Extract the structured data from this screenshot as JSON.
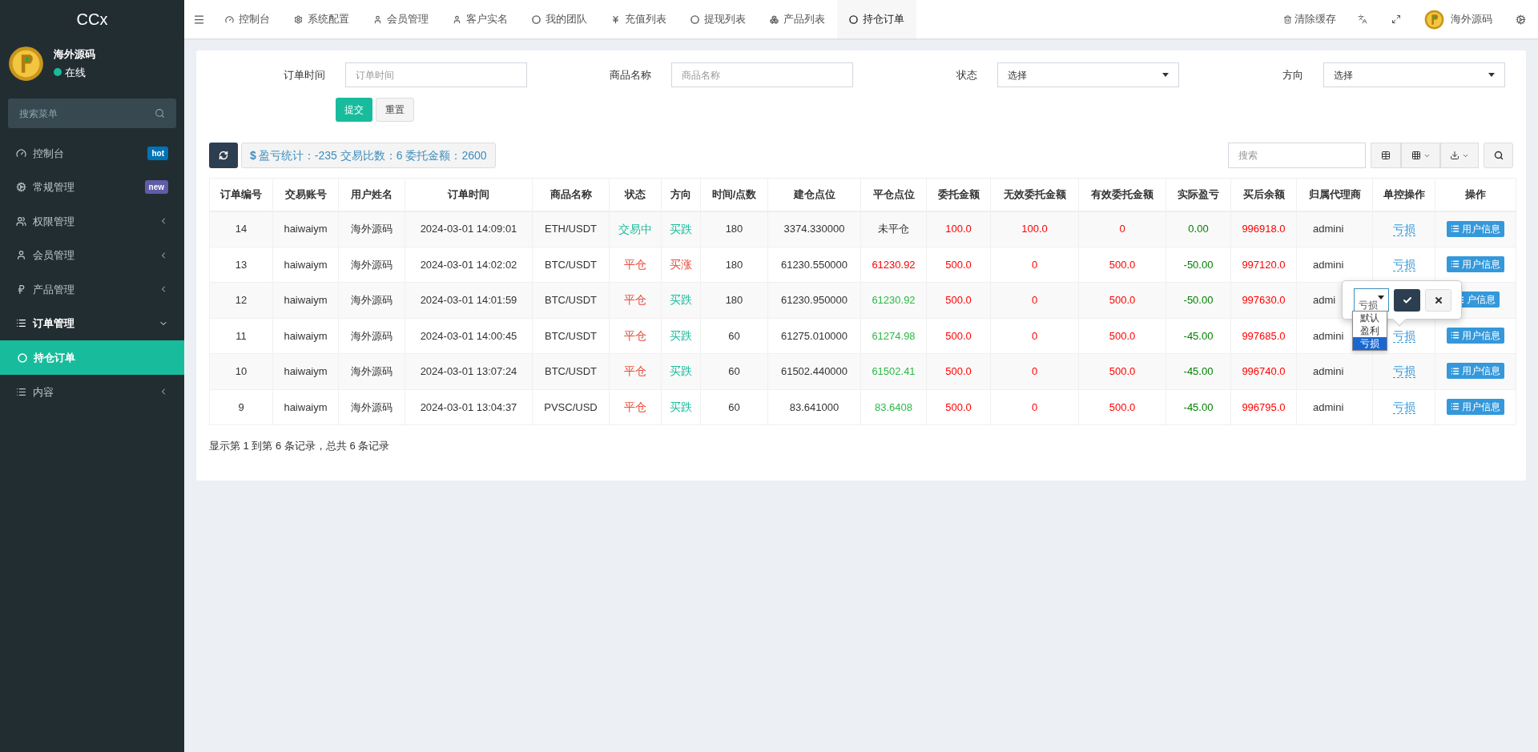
{
  "sidebar": {
    "brand": "CCx",
    "user": {
      "name": "海外源码",
      "status": "在线",
      "online": true
    },
    "search": {
      "placeholder": "搜索菜单"
    },
    "items": [
      {
        "label": "控制台",
        "badge": {
          "text": "hot",
          "color": "#0073b7"
        },
        "selected": false
      },
      {
        "label": "常规管理",
        "badge": {
          "text": "new",
          "color": "#605ca8"
        },
        "selected": false
      },
      {
        "label": "权限管理",
        "has_children": true,
        "expanded": false,
        "selected": false
      },
      {
        "label": "会员管理",
        "has_children": true,
        "expanded": false,
        "selected": false
      },
      {
        "label": "产品管理",
        "has_children": true,
        "expanded": false,
        "selected": false
      },
      {
        "label": "订单管理",
        "has_children": true,
        "expanded": true,
        "selected": false,
        "children": [
          {
            "label": "持仓订单",
            "selected": true
          }
        ]
      },
      {
        "label": "内容",
        "has_children": true,
        "expanded": false,
        "selected": false
      }
    ]
  },
  "topbar": {
    "tabs": [
      {
        "label": "控制台",
        "selected": false
      },
      {
        "label": "系统配置",
        "selected": false
      },
      {
        "label": "会员管理",
        "selected": false
      },
      {
        "label": "客户实名",
        "selected": false
      },
      {
        "label": "我的团队",
        "selected": false
      },
      {
        "label": "充值列表",
        "selected": false
      },
      {
        "label": "提现列表",
        "selected": false
      },
      {
        "label": "产品列表",
        "selected": false
      },
      {
        "label": "持仓订单",
        "selected": true
      }
    ],
    "clear_cache": "清除缓存",
    "user_name": "海外源码"
  },
  "filters": [
    {
      "label": "订单时间",
      "kind": "input",
      "placeholder": "订单时间"
    },
    {
      "label": "商品名称",
      "kind": "input",
      "placeholder": "商品名称"
    },
    {
      "label": "状态",
      "kind": "select",
      "value": "选择"
    },
    {
      "label": "方向",
      "kind": "select",
      "value": "选择"
    }
  ],
  "form_buttons": [
    "提交",
    "重置"
  ],
  "stats_symbol": "$",
  "stats": "盈亏统计：-235 交易比数：6 委托金额：2600",
  "table_search": {
    "placeholder": "搜索"
  },
  "table": {
    "columns": [
      "订单编号",
      "交易账号",
      "用户姓名",
      "订单时间",
      "商品名称",
      "状态",
      "方向",
      "时间/点数",
      "建仓点位",
      "平仓点位",
      "委托金额",
      "无效委托金额",
      "有效委托金额",
      "实际盈亏",
      "买后余额",
      "归属代理商",
      "单控操作",
      "操作"
    ],
    "rows": [
      {
        "id": "14",
        "account": "haiwaiym",
        "name": "海外源码",
        "time": "2024-03-01 14:09:01",
        "product": "ETH/USDT",
        "status": {
          "text": "交易中",
          "color": "#18bc9c"
        },
        "direction": {
          "text": "买跌",
          "color": "#18bc9c"
        },
        "duration": "180",
        "open_price": "3374.330000",
        "close_price": {
          "text": "未平仓",
          "color": "#333333"
        },
        "amount": "100.0",
        "invalid_amount": "100.0",
        "valid_amount": "0",
        "pnl": "0.00",
        "balance": "996918.0",
        "agent": "admini",
        "control": "亏损",
        "action": "用户信息"
      },
      {
        "id": "13",
        "account": "haiwaiym",
        "name": "海外源码",
        "time": "2024-03-01 14:02:02",
        "product": "BTC/USDT",
        "status": {
          "text": "平仓",
          "color": "#e74c3c"
        },
        "direction": {
          "text": "买涨",
          "color": "#e74c3c"
        },
        "duration": "180",
        "open_price": "61230.550000",
        "close_price": {
          "text": "61230.92",
          "color": "#ff0000"
        },
        "amount": "500.0",
        "invalid_amount": "0",
        "valid_amount": "500.0",
        "pnl": "-50.00",
        "balance": "997120.0",
        "agent": "admini",
        "control": "亏损",
        "action": "用户信息"
      },
      {
        "id": "12",
        "account": "haiwaiym",
        "name": "海外源码",
        "time": "2024-03-01 14:01:59",
        "product": "BTC/USDT",
        "status": {
          "text": "平仓",
          "color": "#e74c3c"
        },
        "direction": {
          "text": "买跌",
          "color": "#18bc9c"
        },
        "duration": "180",
        "open_price": "61230.950000",
        "close_price": {
          "text": "61230.92",
          "color": "#2fb74a"
        },
        "amount": "500.0",
        "invalid_amount": "0",
        "valid_amount": "500.0",
        "pnl": "-50.00",
        "balance": "997630.0",
        "agent": "admi",
        "action": "户信息"
      },
      {
        "id": "11",
        "account": "haiwaiym",
        "name": "海外源码",
        "time": "2024-03-01 14:00:45",
        "product": "BTC/USDT",
        "status": {
          "text": "平仓",
          "color": "#e74c3c"
        },
        "direction": {
          "text": "买跌",
          "color": "#18bc9c"
        },
        "duration": "60",
        "open_price": "61275.010000",
        "close_price": {
          "text": "61274.98",
          "color": "#2fb74a"
        },
        "amount": "500.0",
        "invalid_amount": "0",
        "valid_amount": "500.0",
        "pnl": "-45.00",
        "balance": "997685.0",
        "agent": "admini",
        "control": "亏损",
        "action": "用户信息"
      },
      {
        "id": "10",
        "account": "haiwaiym",
        "name": "海外源码",
        "time": "2024-03-01 13:07:24",
        "product": "BTC/USDT",
        "status": {
          "text": "平仓",
          "color": "#e74c3c"
        },
        "direction": {
          "text": "买跌",
          "color": "#18bc9c"
        },
        "duration": "60",
        "open_price": "61502.440000",
        "close_price": {
          "text": "61502.41",
          "color": "#2fb74a"
        },
        "amount": "500.0",
        "invalid_amount": "0",
        "valid_amount": "500.0",
        "pnl": "-45.00",
        "balance": "996740.0",
        "agent": "admini",
        "control": "亏损",
        "action": "用户信息"
      },
      {
        "id": "9",
        "account": "haiwaiym",
        "name": "海外源码",
        "time": "2024-03-01 13:04:37",
        "product": "PVSC/USD",
        "status": {
          "text": "平仓",
          "color": "#e74c3c"
        },
        "direction": {
          "text": "买跌",
          "color": "#18bc9c"
        },
        "duration": "60",
        "open_price": "83.641000",
        "close_price": {
          "text": "83.6408",
          "color": "#2fb74a"
        },
        "amount": "500.0",
        "invalid_amount": "0",
        "valid_amount": "500.0",
        "pnl": "-45.00",
        "balance": "996795.0",
        "agent": "admini",
        "control": "亏损",
        "action": "用户信息"
      }
    ]
  },
  "editor": {
    "value": "亏损",
    "options": [
      {
        "label": "默认",
        "selected": false
      },
      {
        "label": "盈利",
        "selected": false
      },
      {
        "label": "亏损",
        "selected": true
      }
    ]
  },
  "pagination_info": "显示第 1 到第 6 条记录，总共 6 条记录"
}
